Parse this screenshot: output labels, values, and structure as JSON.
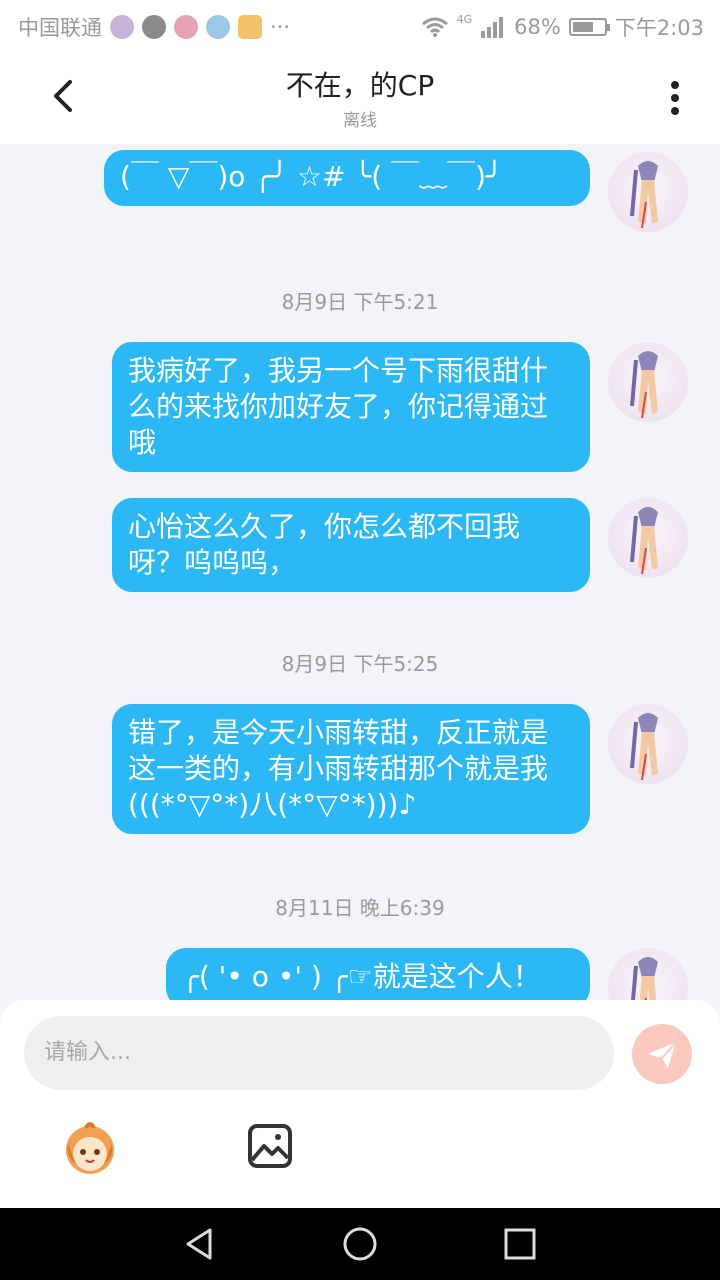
{
  "status_bar": {
    "carrier": "中国联通",
    "more": "···",
    "network": "4G",
    "battery_percent": "68%",
    "battery_level": 0.68,
    "time": "下午2:03"
  },
  "header": {
    "title": "不在，的CP",
    "subtitle": "离线"
  },
  "messages": [
    {
      "type": "bubble",
      "text": "(￣ ▽￣)o ╭╯ ☆# ╰( ￣﹏￣)╯"
    },
    {
      "type": "timestamp",
      "text": "8月9日 下午5:21"
    },
    {
      "type": "bubble",
      "text": "我病好了，我另一个号下雨很甜什么的来找你加好友了，你记得通过哦"
    },
    {
      "type": "bubble",
      "text": "心怡这么久了，你怎么都不回我呀？呜呜呜，"
    },
    {
      "type": "timestamp",
      "text": "8月9日 下午5:25"
    },
    {
      "type": "bubble",
      "text": "错了，是今天小雨转甜，反正就是这一类的，有小雨转甜那个就是我(((*°▽°*)八(*°▽°*)))♪"
    },
    {
      "type": "timestamp",
      "text": "8月11日 晚上6:39"
    },
    {
      "type": "bubble",
      "text": "╭( '• o •' ) ╭☞就是这个人！"
    }
  ],
  "input": {
    "placeholder": "请输入..."
  },
  "icons": {
    "back": "chevron-left-icon",
    "more": "more-vertical-icon",
    "send": "send-icon",
    "emoji": "emoji-sticker-icon",
    "image": "image-icon"
  },
  "colors": {
    "bubble": "#2cb7f5",
    "send_button": "#fbc9bf",
    "background": "#f2f4f7"
  }
}
